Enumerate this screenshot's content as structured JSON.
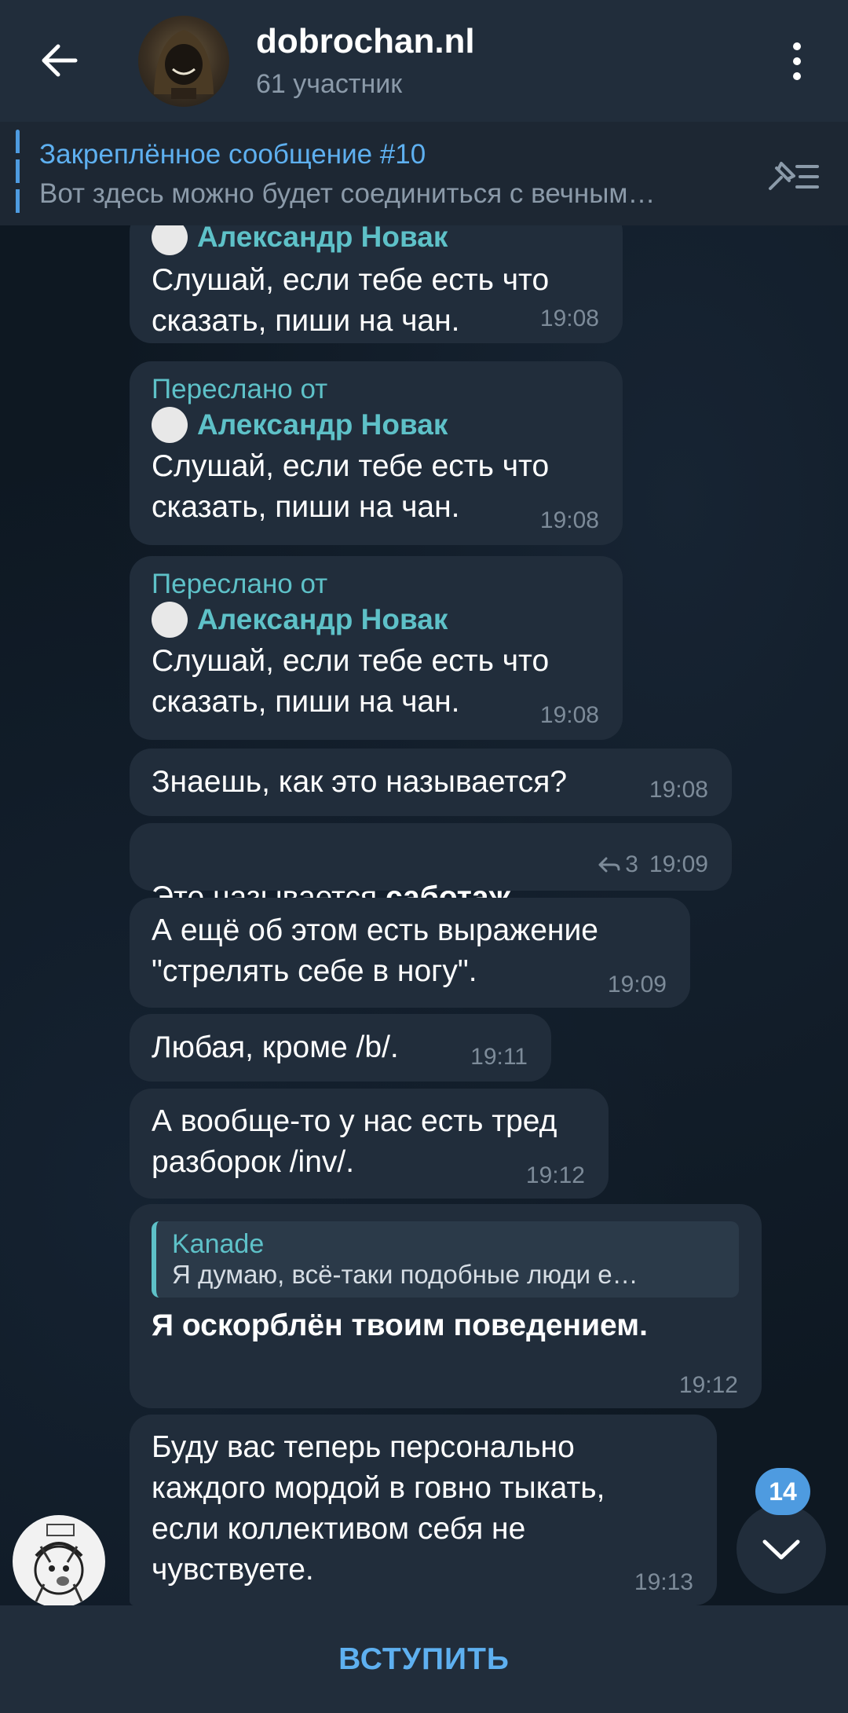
{
  "header": {
    "title": "dobrochan.nl",
    "subtitle": "61 участник"
  },
  "pinned": {
    "title": "Закреплённое сообщение #10",
    "text": "Вот здесь можно будет соединиться с вечным…"
  },
  "messages": [
    {
      "forwarded_label": "",
      "author": "Александр Новак",
      "text": "Слушай, если тебе есть что\nсказать, пиши на чан.",
      "time": "19:08"
    },
    {
      "forwarded_label": "Переслано от",
      "author": "Александр Новак",
      "text": "Слушай, если тебе есть что\nсказать, пиши на чан.",
      "time": "19:08"
    },
    {
      "forwarded_label": "Переслано от",
      "author": "Александр Новак",
      "text": "Слушай, если тебе есть что\nсказать, пиши на чан.",
      "time": "19:08"
    },
    {
      "text": "Знаешь, как это называется?",
      "time": "19:08"
    },
    {
      "text_before": "Это называется ",
      "text_bold": "саботаж",
      "text_after": ".",
      "replies": "3",
      "time": "19:09"
    },
    {
      "text": "А ещё об этом есть выражение\n\"стрелять себе в ногу\".",
      "time": "19:09"
    },
    {
      "text": "Любая, кроме /b/.",
      "time": "19:11"
    },
    {
      "text": "А вообще-то у нас есть тред\nразборок /inv/.",
      "time": "19:12"
    },
    {
      "reply_author": "Kanade",
      "reply_text": "Я думаю, всё-таки подобные люди е…",
      "text": "Я оскорблён твоим поведением.",
      "time": "19:12"
    },
    {
      "text": "Буду вас теперь персонально\nкаждого мордой в говно тыкать,\nесли коллективом себя не\nчувствуете.",
      "time": "19:13"
    }
  ],
  "unread_count": "14",
  "bottom": {
    "join_label": "ВСТУПИТЬ"
  }
}
